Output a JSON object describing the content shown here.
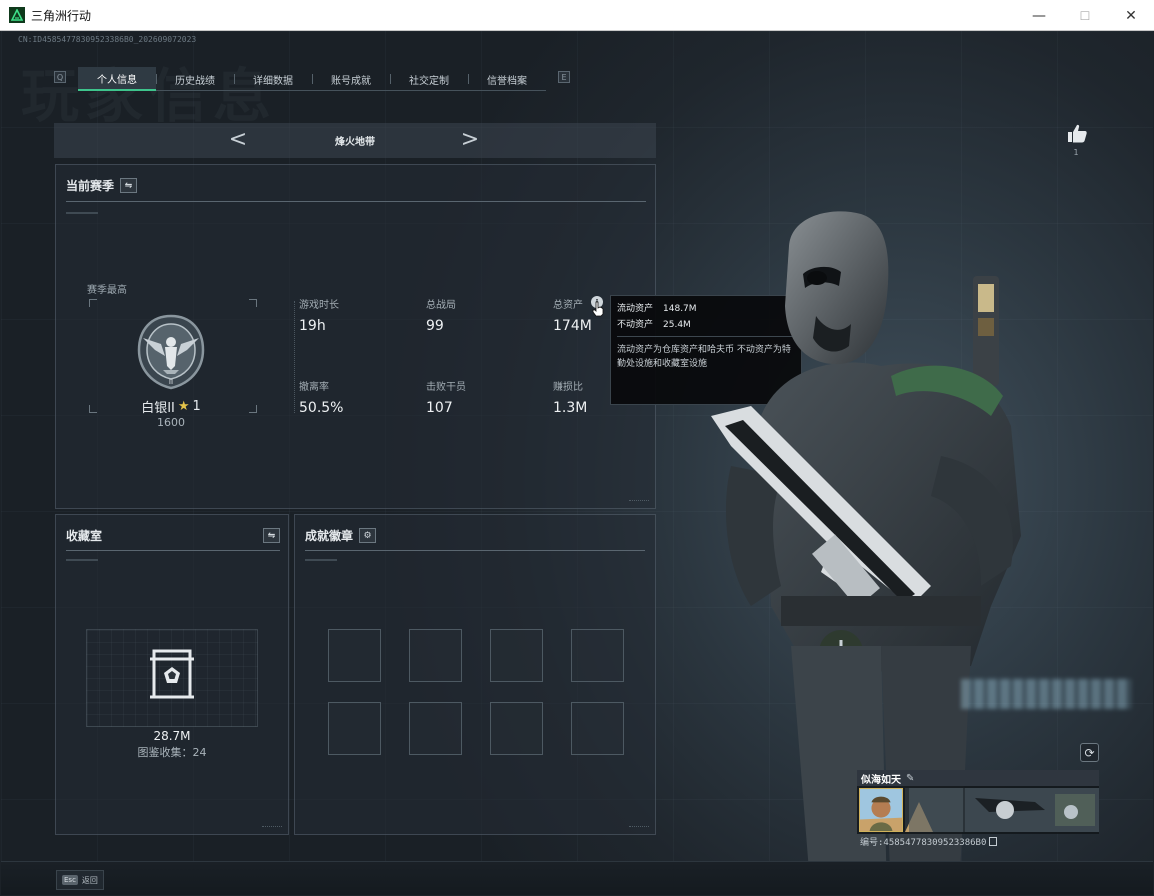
{
  "window": {
    "title": "三角洲行动",
    "minimize": "—",
    "maximize": "☐",
    "close": "✕"
  },
  "session_id": "CN:ID45854778309523386B0_202609072023",
  "watermark": "玩家信息",
  "tabs": [
    {
      "label": "个人信息",
      "active": true
    },
    {
      "label": "历史战绩",
      "active": false
    },
    {
      "label": "详细数据",
      "active": false
    },
    {
      "label": "账号成就",
      "active": false
    },
    {
      "label": "社交定制",
      "active": false
    },
    {
      "label": "信誉档案",
      "active": false
    }
  ],
  "tab_prev_key": "Q",
  "tab_next_key": "E",
  "map_selector": {
    "name": "烽火地带",
    "prev": "<",
    "next": ">"
  },
  "season": {
    "title": "当前赛季",
    "swap_icon": "⇋",
    "best_label": "赛季最高",
    "rank_name": "白银II",
    "rank_stars": "1",
    "rank_score": "1600",
    "stats": [
      {
        "label": "游戏时长",
        "value": "19h"
      },
      {
        "label": "总战局",
        "value": "99"
      },
      {
        "label": "总资产",
        "value": "174M"
      },
      {
        "label": "撤离率",
        "value": "50.5%"
      },
      {
        "label": "击败干员",
        "value": "107"
      },
      {
        "label": "赚损比",
        "value": "1.3M"
      }
    ]
  },
  "tooltip": {
    "liquid_label": "流动资产",
    "liquid_value": "148.7M",
    "fixed_label": "不动资产",
    "fixed_value": "25.4M",
    "note": "流动资产为仓库资产和哈夫币   不动资产为特勤处设施和收藏室设施"
  },
  "collection": {
    "title": "收藏室",
    "swap_icon": "⇋",
    "value": "28.7M",
    "count_text": "图鉴收集：24"
  },
  "badges": {
    "title": "成就徽章",
    "settings_icon": "⚙",
    "slots": 8
  },
  "profile": {
    "like_count": "1",
    "player_name": "似海如天",
    "uid_text": "编号:45854778309523386B0",
    "refresh_icon": "⟳",
    "edit_icon": "✎"
  },
  "footer": {
    "esc_key": "Esc",
    "esc_label": "返回"
  },
  "colors": {
    "accent": "#3ec48c",
    "rank_star": "#e5c44a",
    "panel_border": "#78879466"
  },
  "icons": [
    "app-logo-icon",
    "like-icon",
    "info-icon",
    "cursor-hand-icon",
    "vault-display-icon",
    "rank-eagle-emblem",
    "copy-icon"
  ]
}
